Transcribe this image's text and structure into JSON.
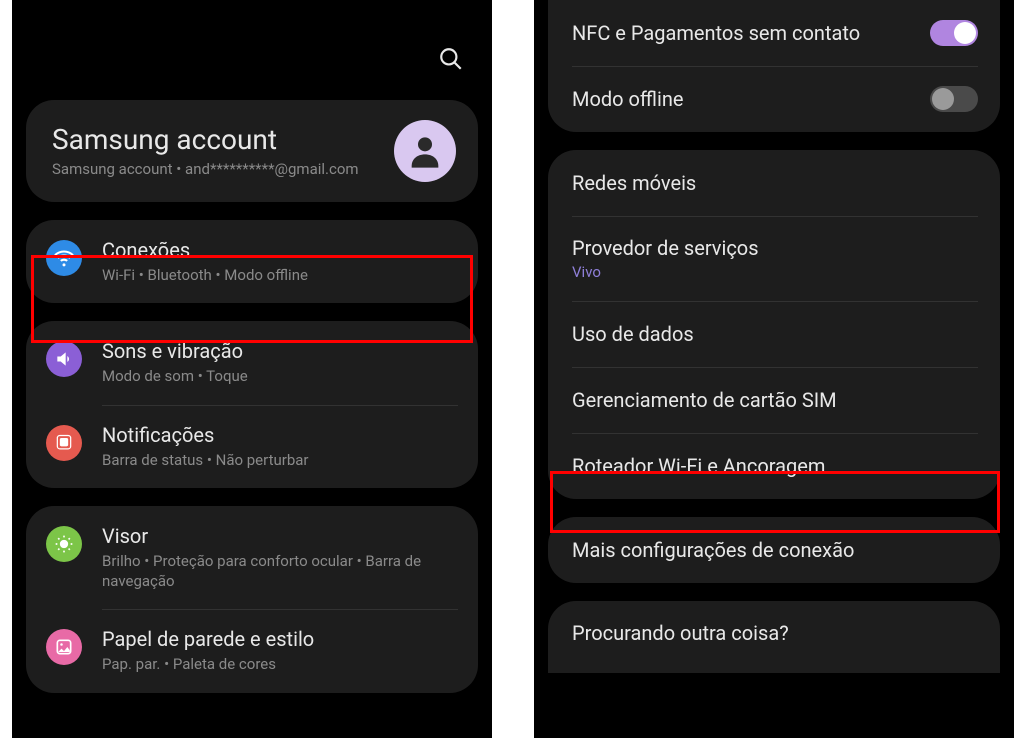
{
  "left": {
    "account": {
      "title": "Samsung account",
      "subtitle": "Samsung account  •  and**********@gmail.com"
    },
    "groups": [
      {
        "items": [
          {
            "label": "Conexões",
            "sub": "Wi-Fi  •  Bluetooth  •  Modo offline",
            "icon": "wifi",
            "color": "blue",
            "highlighted": true
          }
        ]
      },
      {
        "items": [
          {
            "label": "Sons e vibração",
            "sub": "Modo de som  •  Toque",
            "icon": "sound",
            "color": "purple"
          },
          {
            "label": "Notificações",
            "sub": "Barra de status  •  Não perturbar",
            "icon": "notif",
            "color": "red"
          }
        ]
      },
      {
        "items": [
          {
            "label": "Visor",
            "sub": "Brilho  •  Proteção para conforto ocular  •  Barra de navegação",
            "icon": "display",
            "color": "green"
          },
          {
            "label": "Papel de parede e estilo",
            "sub": "Pap. par.  •  Paleta de cores",
            "icon": "wallpaper",
            "color": "pink"
          }
        ]
      }
    ]
  },
  "right": {
    "sections": [
      {
        "top": true,
        "items": [
          {
            "label": "NFC e Pagamentos sem contato",
            "toggle": "on"
          },
          {
            "label": "Modo offline",
            "toggle": "off"
          }
        ]
      },
      {
        "items": [
          {
            "label": "Redes móveis"
          },
          {
            "label": "Provedor de serviços",
            "sub": "Vivo"
          },
          {
            "label": "Uso de dados"
          },
          {
            "label": "Gerenciamento de cartão SIM"
          },
          {
            "label": "Roteador Wi-Fi e Ancoragem",
            "highlighted": true
          }
        ]
      },
      {
        "items": [
          {
            "label": "Mais configurações de conexão"
          }
        ]
      },
      {
        "last": true,
        "items": [
          {
            "label": "Procurando outra coisa?"
          }
        ]
      }
    ]
  }
}
